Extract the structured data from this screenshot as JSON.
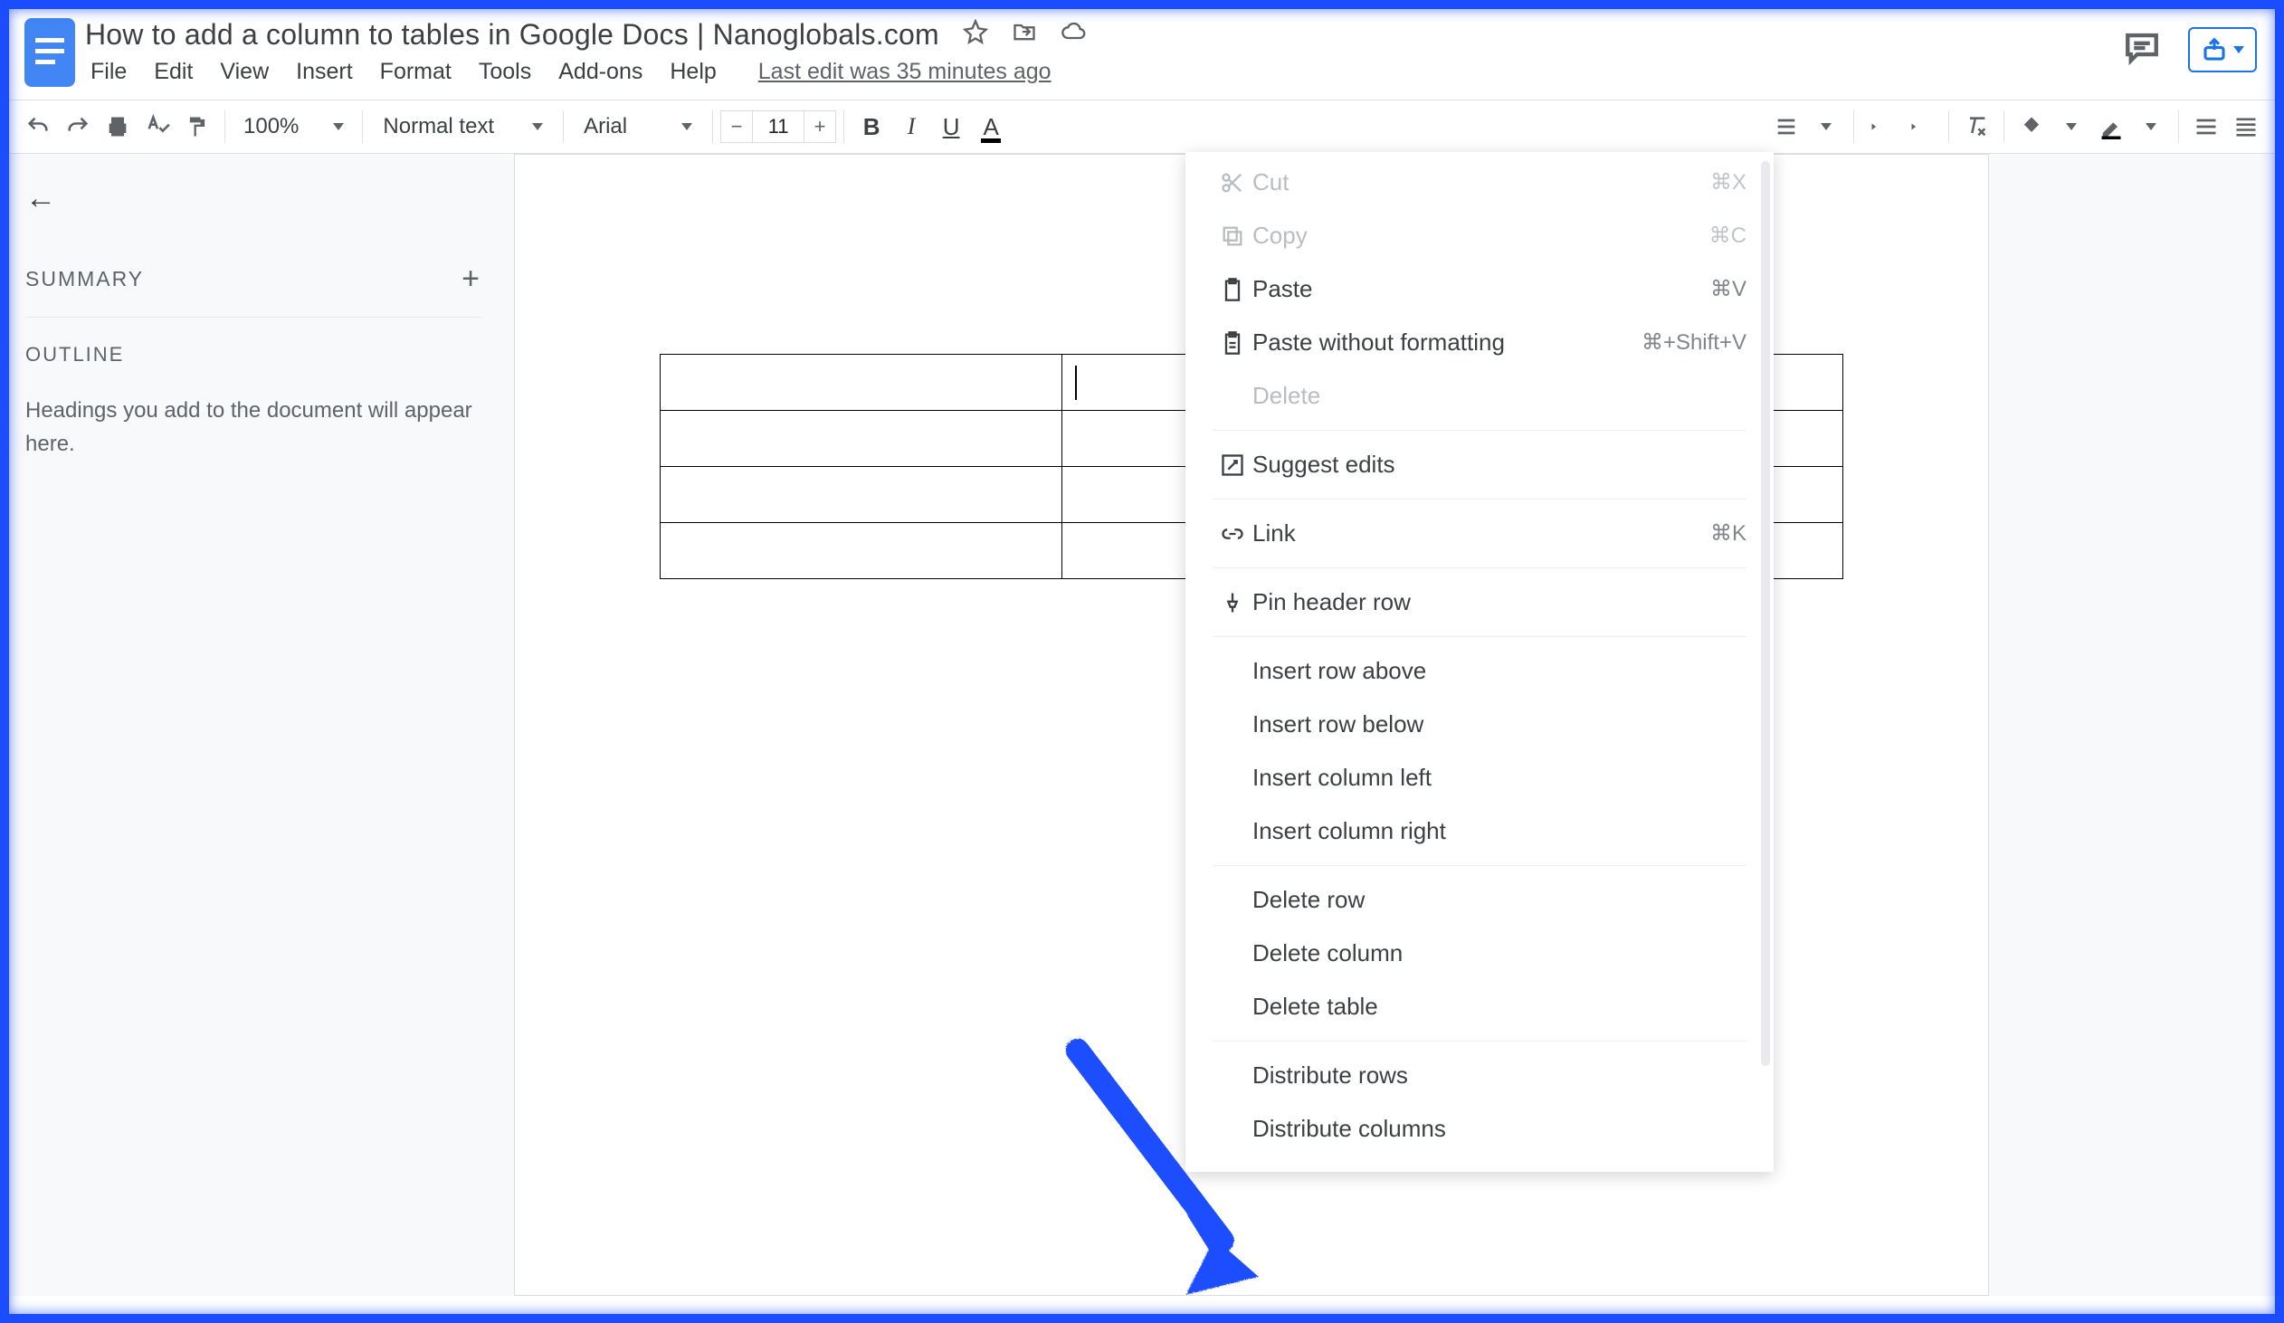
{
  "doc": {
    "title": "How to add a column to tables in Google Docs | Nanoglobals.com",
    "last_edit": "Last edit was 35 minutes ago"
  },
  "menus": [
    "File",
    "Edit",
    "View",
    "Insert",
    "Format",
    "Tools",
    "Add-ons",
    "Help"
  ],
  "toolbar": {
    "zoom": "100%",
    "style": "Normal text",
    "font": "Arial",
    "size": "11"
  },
  "sidebar": {
    "summary_label": "SUMMARY",
    "outline_label": "OUTLINE",
    "outline_hint": "Headings you add to the document will appear here."
  },
  "context_menu": {
    "cut": {
      "label": "Cut",
      "shortcut": "⌘X"
    },
    "copy": {
      "label": "Copy",
      "shortcut": "⌘C"
    },
    "paste": {
      "label": "Paste",
      "shortcut": "⌘V"
    },
    "paste_plain": {
      "label": "Paste without formatting",
      "shortcut": "⌘+Shift+V"
    },
    "delete": {
      "label": "Delete"
    },
    "suggest": {
      "label": "Suggest edits"
    },
    "link": {
      "label": "Link",
      "shortcut": "⌘K"
    },
    "pin": {
      "label": "Pin header row"
    },
    "row_above": {
      "label": "Insert row above"
    },
    "row_below": {
      "label": "Insert row below"
    },
    "col_left": {
      "label": "Insert column left"
    },
    "col_right": {
      "label": "Insert column right"
    },
    "del_row": {
      "label": "Delete row"
    },
    "del_col": {
      "label": "Delete column"
    },
    "del_table": {
      "label": "Delete table"
    },
    "dist_rows": {
      "label": "Distribute rows"
    },
    "dist_cols": {
      "label": "Distribute columns"
    }
  },
  "table": {
    "rows": 4,
    "cols": 3
  }
}
